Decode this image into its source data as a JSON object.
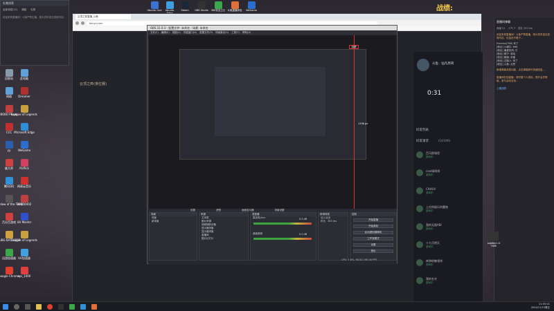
{
  "desktop_top_icons": [
    {
      "label": "Ubuntu One",
      "color": "#3b74d0"
    },
    {
      "label": "Ubuntu Edge",
      "color": "#3fa0e0"
    },
    {
      "label": "Steam",
      "color": "#1b2838"
    },
    {
      "label": "OBS Studio",
      "color": "#333333"
    },
    {
      "label": "360安全卫士",
      "color": "#3ca64a"
    },
    {
      "label": "斗鱼直播伴侣",
      "color": "#e1703b"
    },
    {
      "label": "WeGame",
      "color": "#2b6ecf"
    }
  ],
  "overlay_text": "战绩:",
  "desktop_left_icons": [
    {
      "label": "回收站",
      "color": "#8899aa"
    },
    {
      "label": "此电脑",
      "color": "#5fa0d8"
    },
    {
      "label": "网络",
      "color": "#5fa0d8"
    },
    {
      "label": "Dreamer",
      "color": "#b03030"
    },
    {
      "label": "BOBO Player",
      "color": "#c04040"
    },
    {
      "label": "League of Legends",
      "color": "#c8a040"
    },
    {
      "label": "CCC",
      "color": "#c03030"
    },
    {
      "label": "Microsoft Edge",
      "color": "#2e8fd6"
    },
    {
      "label": "yy",
      "color": "#2a5fb0"
    },
    {
      "label": "WeGame",
      "color": "#2b6ecf"
    },
    {
      "label": "鲁大师",
      "color": "#d04040"
    },
    {
      "label": "PicPick",
      "color": "#d04060"
    },
    {
      "label": "腾讯QQ",
      "color": "#3090d8"
    },
    {
      "label": "网易云音乐",
      "color": "#d03030"
    },
    {
      "label": "Shadow of the Tomb",
      "color": "#555555"
    },
    {
      "label": "20250402",
      "color": "#c04040"
    },
    {
      "label": "百分百游戏",
      "color": "#d04040"
    },
    {
      "label": "UU Master",
      "color": "#3050d0"
    },
    {
      "label": "PUBG BATTLEGR",
      "color": "#d0a040"
    },
    {
      "label": "League of Legends",
      "color": "#c8a040"
    },
    {
      "label": "迅游加速器",
      "color": "#3ca64a"
    },
    {
      "label": "UU加速器",
      "color": "#40a0e0"
    },
    {
      "label": "Google Chrome",
      "color": "#e04030"
    },
    {
      "label": "sys_1000",
      "color": "#e04040"
    }
  ],
  "right_desktop_icon": {
    "label": "Logitech G HUB"
  },
  "left_panel": {
    "title": "礼物消息",
    "tabs": [
      "全部消息(12)",
      "弹幕",
      "礼物"
    ],
    "body": "欢迎来到直播间！斗鱼严禁主播、观众发布违法违规内容。"
  },
  "browser": {
    "tab_title": "云顶之弈直播_斗鱼",
    "url": "douyu.com",
    "page_title": "云顶之弈(排位赛)",
    "streamer": "斗鱼 · 仙凡周哥",
    "timer": "0:31",
    "section_friends": "好友列表",
    "section_list": "好友请求",
    "count": "(14/346)",
    "friends": [
      {
        "name": "百马欧瑞思",
        "status": "游戏中"
      },
      {
        "name": "cool绿岗线",
        "status": "游戏中"
      },
      {
        "name": "CAHUV",
        "status": "游戏中"
      },
      {
        "name": "上位的极乐的魔鬼",
        "status": "游戏中"
      },
      {
        "name": "我的无限ABI",
        "status": "游戏中"
      },
      {
        "name": "十七月明天",
        "status": "游戏中"
      },
      {
        "name": "肉弥粉集领排",
        "status": "游戏中"
      },
      {
        "name": "我的名字",
        "status": "游戏中"
      }
    ]
  },
  "obs": {
    "title": "OBS 31.0.3 - 配置文件: 未命名 - 场景: 未命名",
    "menu": [
      "文件(F)",
      "编辑(E)",
      "视图(V)",
      "停靠窗口(D)",
      "配置文件(P)",
      "场景集合(S)",
      "工具(T)",
      "帮助(H)"
    ],
    "preview_size_label": "1336 px",
    "preview_red_label": "战绩",
    "toolbar": [
      "设置",
      "滤镜",
      "画面显示器",
      "场景设置"
    ],
    "docks": {
      "scenes": {
        "header": "场景",
        "items": [
          "场景",
          "新场景"
        ]
      },
      "sources": {
        "header": "来源",
        "items": [
          "文本框",
          "图片来源",
          "视频捕获设备",
          "显示器采集",
          "显示器采集",
          "直播间",
          "图片幻灯片"
        ]
      },
      "mixer": {
        "header": "混音器",
        "tracks": [
          {
            "name": "麦克风/Aux",
            "db": "0.0 dB"
          },
          {
            "name": "桌面音频",
            "db": "0.0 dB"
          }
        ]
      },
      "transitions": {
        "header": "转场特效",
        "value": "淡入淡出",
        "duration_label": "时长",
        "duration": "300 ms"
      },
      "controls": {
        "header": "控制",
        "buttons": [
          "开始直播",
          "开始录制",
          "启动虚拟摄像机",
          "工作室模式",
          "设置",
          "退出"
        ]
      }
    },
    "status": "CPU: 1.8%, 60.00 / 60.00 FPS"
  },
  "right_panel": {
    "title": "直播间弹幕",
    "stats": [
      "贡献 51",
      "人气 3",
      "送礼 292.0w"
    ],
    "notice": "欢迎来到直播间！斗鱼严禁直播、观众发布违法违规内容，包括但不限于...",
    "chat": [
      "Promise(780) 来了",
      "[粉丝] 小蜗牛: 666",
      "[粉丝] 最爱的风: 牛",
      "[粉丝] 橘子: 哈哈",
      "[粉丝] 跑跑: 厉害",
      "[粉丝] 过路人: 来了",
      "[粉丝] 斗鱼: 点赞"
    ],
    "system_msg": "新增弹幕消息功能，点击弹幕即可快速回复...",
    "system_msg2": "直播间在线直播：请完善个人资料，提升会员等级，参与活动互动...",
    "link": "上期回顾"
  },
  "taskbar": {
    "time": "21:55:01",
    "date": "2024/11/15周五"
  }
}
